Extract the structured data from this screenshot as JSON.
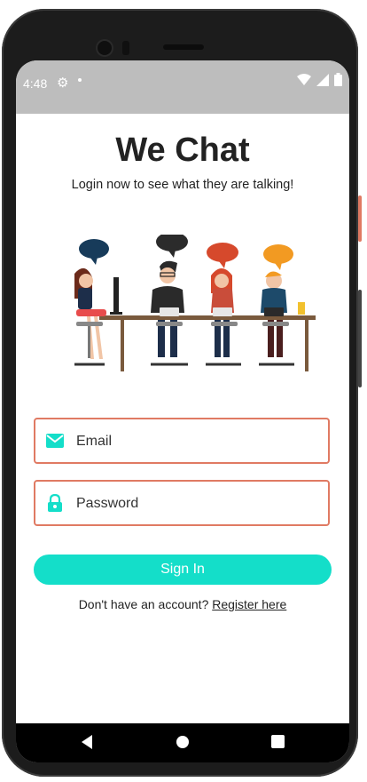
{
  "status_bar": {
    "time": "4:48"
  },
  "header": {
    "title": "We Chat",
    "subtitle": "Login now to see what they are talking!"
  },
  "form": {
    "email_placeholder": "Email",
    "password_placeholder": "Password",
    "signin_label": "Sign In"
  },
  "footer": {
    "prompt": "Don't have an account?",
    "register_label": "Register here"
  },
  "colors": {
    "accent": "#14dec9",
    "field_border": "#e07a63",
    "status_bar": "#bdbdbd"
  },
  "icons": {
    "status": [
      "gear-icon",
      "wifi-icon",
      "cellular-icon",
      "battery-icon"
    ],
    "fields": [
      "email-icon",
      "lock-icon"
    ],
    "nav": [
      "back-icon",
      "home-icon",
      "recents-icon"
    ]
  }
}
